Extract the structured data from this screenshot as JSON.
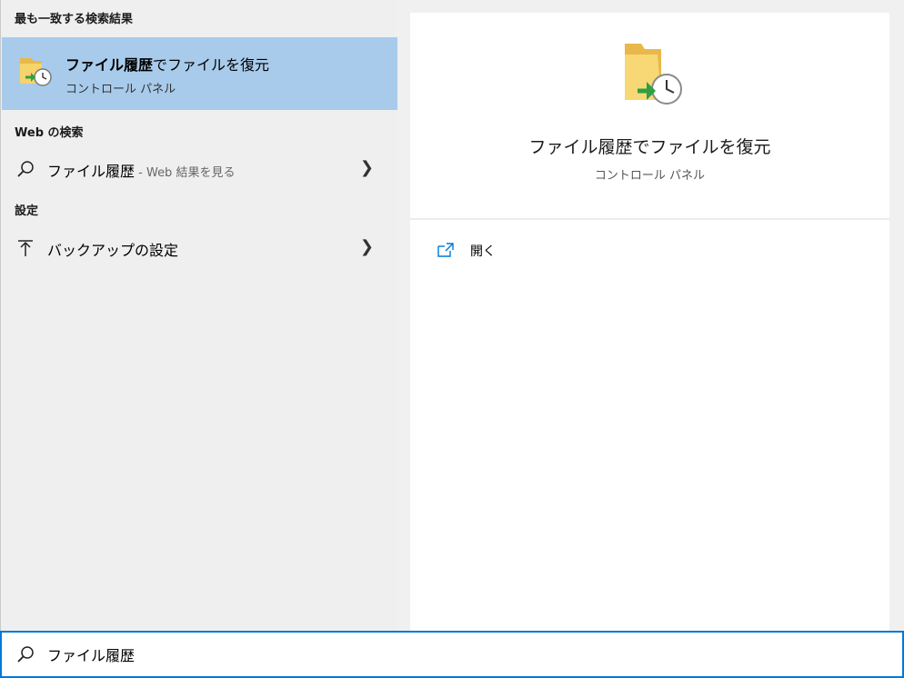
{
  "sections": {
    "best_match_heading": "最も一致する検索結果",
    "web_heading": "Web の検索",
    "settings_heading": "設定"
  },
  "best_match": {
    "title_bold": "ファイル履歴",
    "title_rest": "でファイルを復元",
    "subtitle": "コントロール パネル",
    "icon": "file-history-folder-icon"
  },
  "web_result": {
    "query": "ファイル履歴",
    "hint": " - Web 結果を見る",
    "icon": "search-icon"
  },
  "settings_result": {
    "label": "バックアップの設定",
    "icon": "backup-arrow-icon"
  },
  "preview": {
    "title": "ファイル履歴でファイルを復元",
    "subtitle": "コントロール パネル",
    "open_label": "開く"
  },
  "search": {
    "value": "ファイル履歴"
  },
  "colors": {
    "selected_bg": "#a8cbeb",
    "accent": "#0078d7"
  }
}
